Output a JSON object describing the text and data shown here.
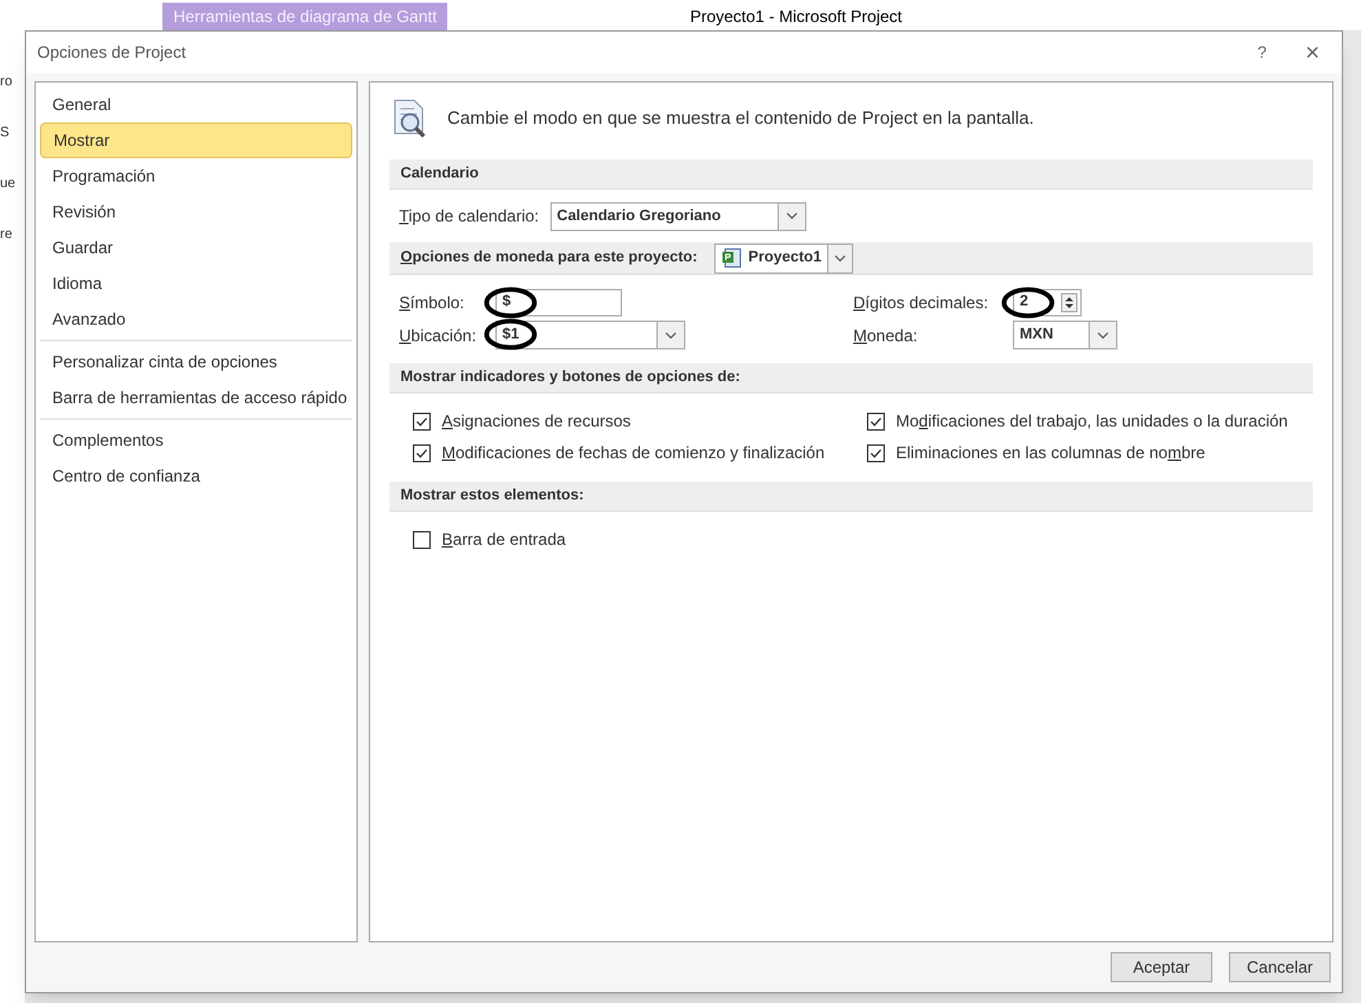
{
  "app_window": {
    "context_tab": "Herramientas de diagrama de Gantt",
    "title": "Proyecto1 - Microsoft Project",
    "edge_fragments": [
      "ro",
      "S",
      "ue",
      "re"
    ]
  },
  "dialog": {
    "title": "Opciones de Project",
    "help": "?",
    "close": "×"
  },
  "nav": {
    "groups": [
      [
        {
          "label": "General",
          "selected": false
        },
        {
          "label": "Mostrar",
          "selected": true
        },
        {
          "label": "Programación",
          "selected": false
        },
        {
          "label": "Revisión",
          "selected": false
        },
        {
          "label": "Guardar",
          "selected": false
        },
        {
          "label": "Idioma",
          "selected": false
        },
        {
          "label": "Avanzado",
          "selected": false
        }
      ],
      [
        {
          "label": "Personalizar cinta de opciones",
          "selected": false
        },
        {
          "label": "Barra de herramientas de acceso rápido",
          "selected": false
        }
      ],
      [
        {
          "label": "Complementos",
          "selected": false
        },
        {
          "label": "Centro de confianza",
          "selected": false
        }
      ]
    ]
  },
  "header": "Cambie el modo en que se muestra el contenido de Project en la pantalla.",
  "calendar": {
    "title": "Calendario",
    "label": {
      "key": "T",
      "post": "ipo de calendario:"
    },
    "value": "Calendario Gregoriano"
  },
  "currency": {
    "label": {
      "key": "O",
      "post": "pciones de moneda para este proyecto:"
    },
    "project": "Proyecto1",
    "symbol": {
      "label": {
        "key": "S",
        "post": "ímbolo:"
      },
      "value": "$",
      "circled": true
    },
    "placement": {
      "label": {
        "key": "U",
        "post": "bicación:"
      },
      "value": "$1",
      "circled": true
    },
    "decimals": {
      "label": {
        "key": "D",
        "post": "ígitos decimales:"
      },
      "value": "2",
      "circled": true
    },
    "currency_code": {
      "label": {
        "key": "M",
        "post": "oneda:"
      },
      "value": "MXN",
      "circled": false
    }
  },
  "indicators": {
    "title": "Mostrar indicadores y botones de opciones de:",
    "options": [
      {
        "label": {
          "key": "A",
          "post": "signaciones de recursos"
        },
        "checked": true
      },
      {
        "label": {
          "pre": "Mo",
          "key": "d",
          "post": "ificaciones del trabajo, las unidades o la duración"
        },
        "checked": true
      },
      {
        "label": {
          "key": "M",
          "post": "odificaciones de fechas de comienzo y finalización"
        },
        "checked": true
      },
      {
        "label": {
          "pre": "Eliminaciones en las columnas de no",
          "key": "m",
          "post": "bre"
        },
        "checked": true
      }
    ]
  },
  "elements": {
    "title": "Mostrar estos elementos:",
    "options": [
      {
        "label": {
          "key": "B",
          "post": "arra de entrada"
        },
        "checked": false
      }
    ]
  },
  "buttons": [
    "Aceptar",
    "Cancelar"
  ]
}
